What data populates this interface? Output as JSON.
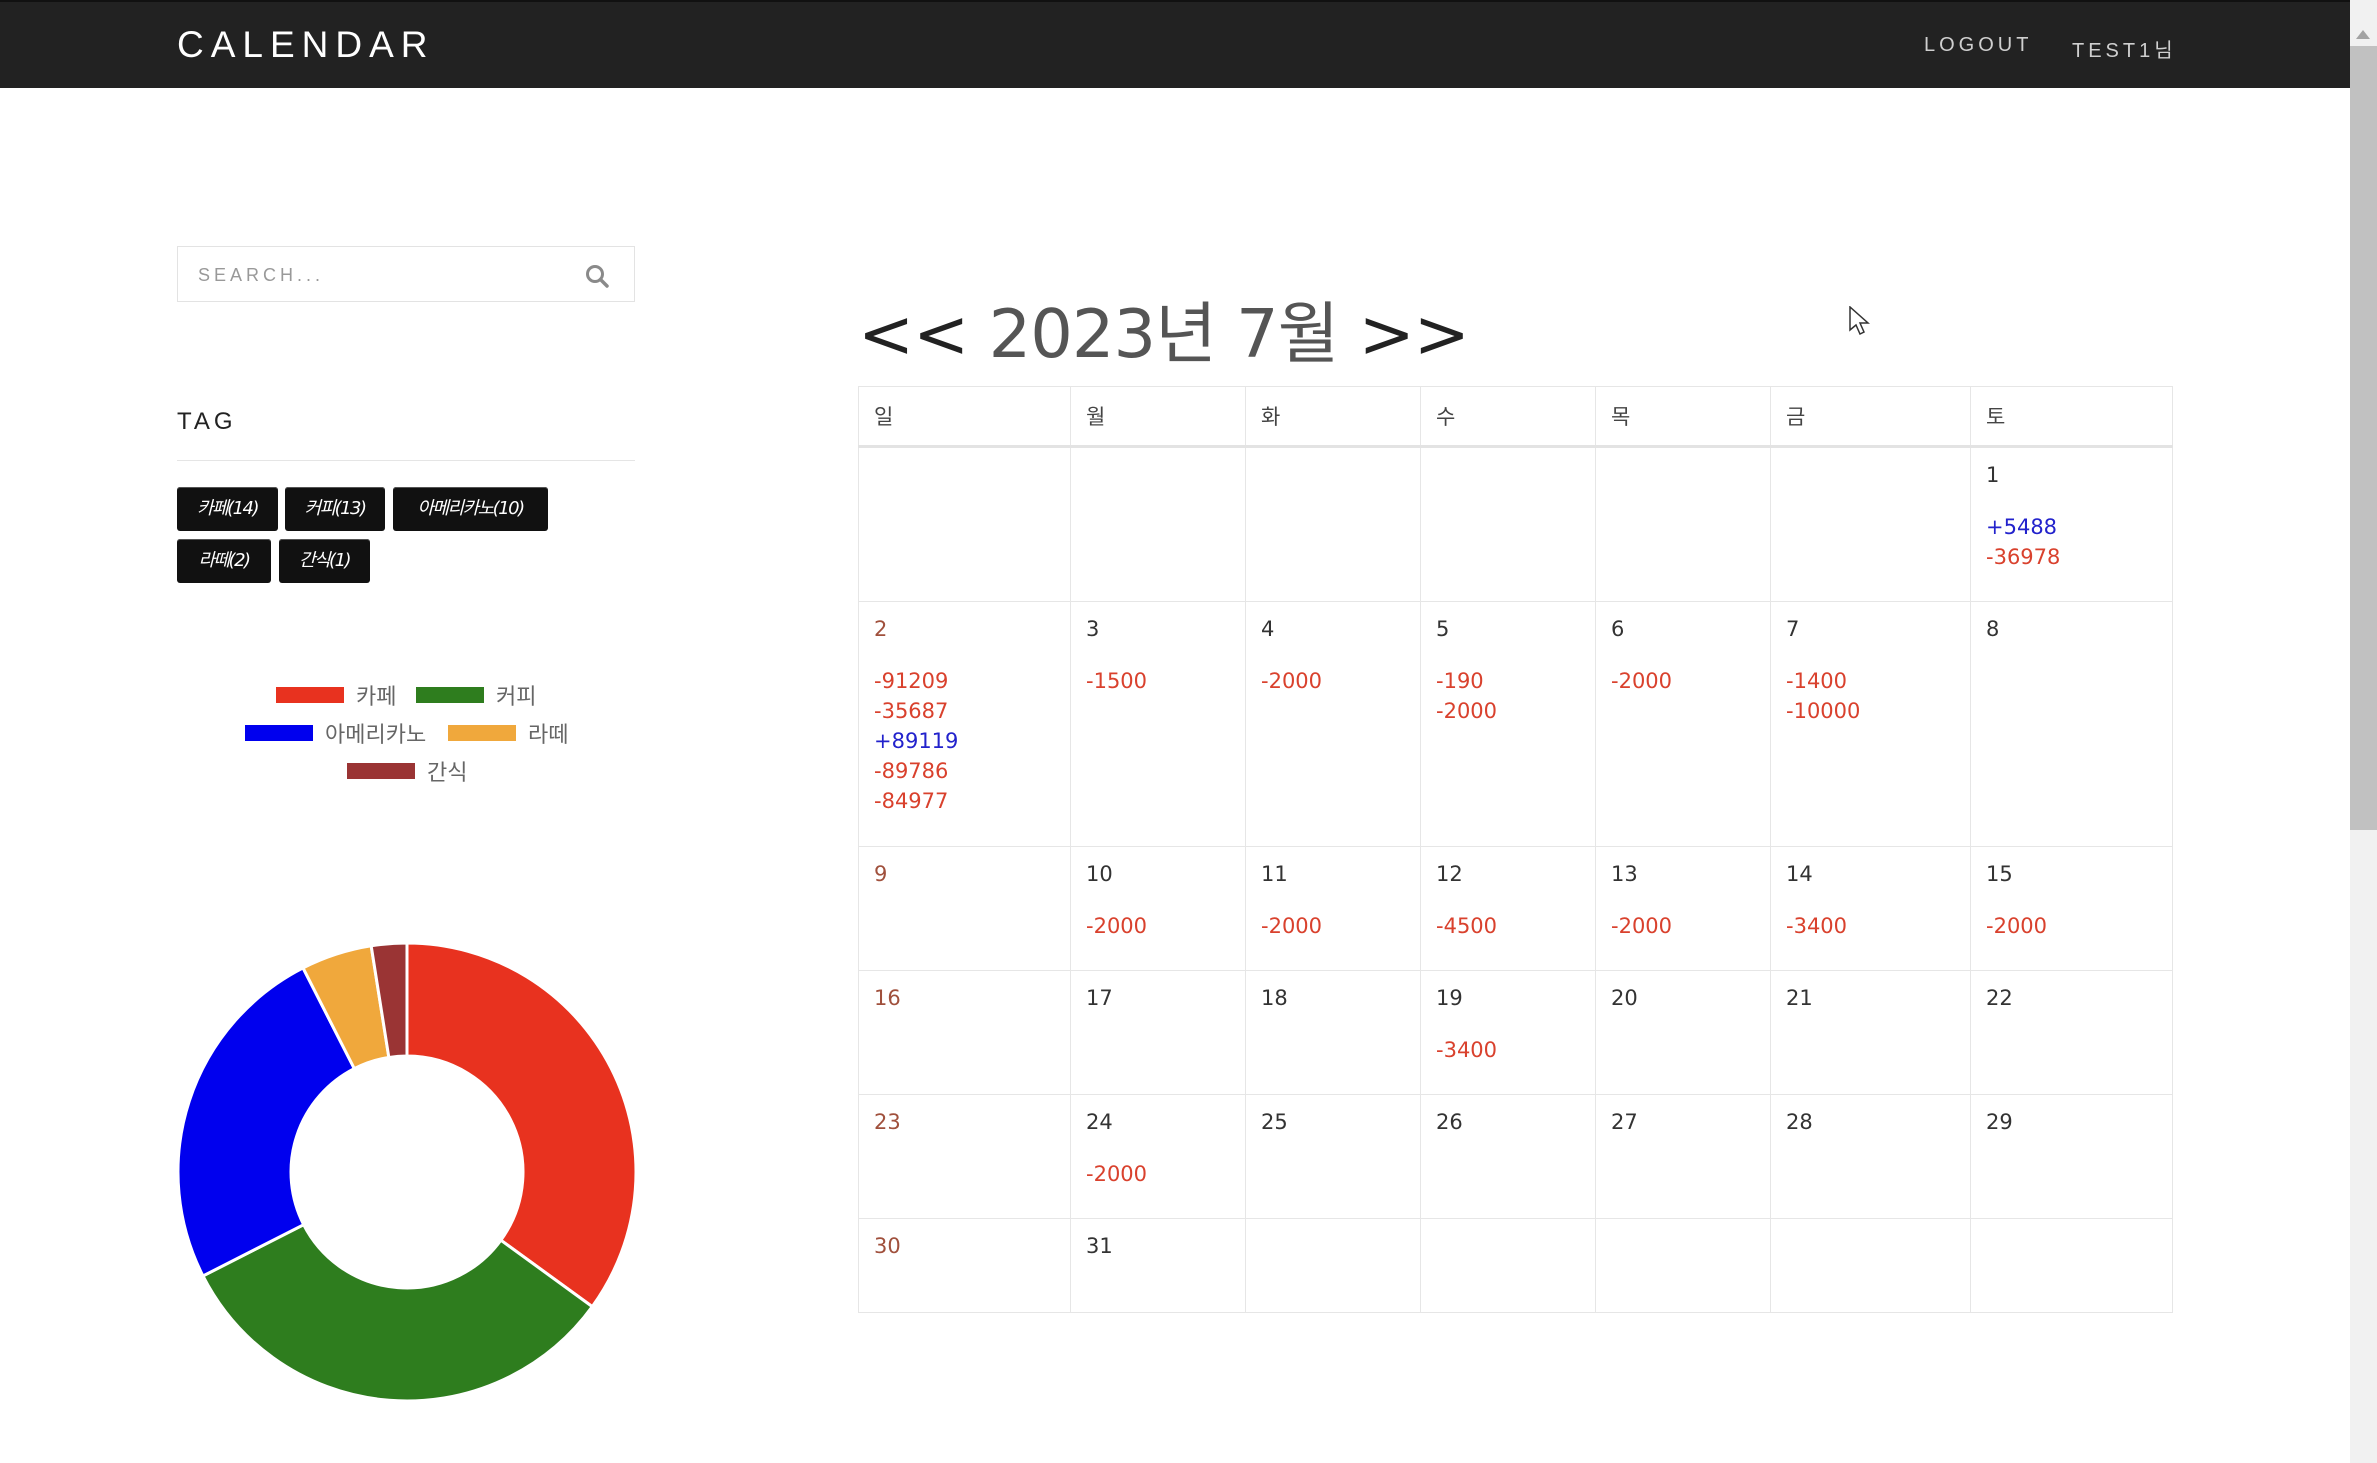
{
  "header": {
    "brand": "CALENDAR",
    "logout": "LOGOUT",
    "user": "TEST1님"
  },
  "sidebar": {
    "search_placeholder": "SEARCH...",
    "tag_heading": "TAG",
    "tags": [
      {
        "label": "카페(14)"
      },
      {
        "label": "커피(13)"
      },
      {
        "label": "아메리카노(10)"
      },
      {
        "label": "라떼(2)"
      },
      {
        "label": "간식(1)"
      }
    ]
  },
  "chart_data": {
    "type": "pie",
    "title": "",
    "categories": [
      "카페",
      "커피",
      "아메리카노",
      "라떼",
      "간식"
    ],
    "values": [
      14,
      13,
      10,
      2,
      1
    ],
    "colors": [
      "#e8321f",
      "#2e7d1e",
      "#0000ee",
      "#f0a83c",
      "#9a3434"
    ],
    "donut": true,
    "legend_position": "top"
  },
  "calendar": {
    "title_prefix": "<<",
    "title": "2023년 7월",
    "title_suffix": ">>",
    "weekdays": [
      "일",
      "월",
      "화",
      "수",
      "목",
      "금",
      "토"
    ],
    "weeks": [
      [
        {
          "day": "",
          "amounts": []
        },
        {
          "day": "",
          "amounts": []
        },
        {
          "day": "",
          "amounts": []
        },
        {
          "day": "",
          "amounts": []
        },
        {
          "day": "",
          "amounts": []
        },
        {
          "day": "",
          "amounts": []
        },
        {
          "day": "1",
          "amounts": [
            "+5488",
            "-36978"
          ]
        }
      ],
      [
        {
          "day": "2",
          "amounts": [
            "-91209",
            "-35687",
            "+89119",
            "-89786",
            "-84977"
          ]
        },
        {
          "day": "3",
          "amounts": [
            "-1500"
          ]
        },
        {
          "day": "4",
          "amounts": [
            "-2000"
          ]
        },
        {
          "day": "5",
          "amounts": [
            "-190",
            "-2000"
          ]
        },
        {
          "day": "6",
          "amounts": [
            "-2000"
          ]
        },
        {
          "day": "7",
          "amounts": [
            "-1400",
            "-10000"
          ]
        },
        {
          "day": "8",
          "amounts": []
        }
      ],
      [
        {
          "day": "9",
          "amounts": []
        },
        {
          "day": "10",
          "amounts": [
            "-2000"
          ]
        },
        {
          "day": "11",
          "amounts": [
            "-2000"
          ]
        },
        {
          "day": "12",
          "amounts": [
            "-4500"
          ]
        },
        {
          "day": "13",
          "amounts": [
            "-2000"
          ]
        },
        {
          "day": "14",
          "amounts": [
            "-3400"
          ]
        },
        {
          "day": "15",
          "amounts": [
            "-2000"
          ]
        }
      ],
      [
        {
          "day": "16",
          "amounts": []
        },
        {
          "day": "17",
          "amounts": []
        },
        {
          "day": "18",
          "amounts": []
        },
        {
          "day": "19",
          "amounts": [
            "-3400"
          ]
        },
        {
          "day": "20",
          "amounts": []
        },
        {
          "day": "21",
          "amounts": []
        },
        {
          "day": "22",
          "amounts": []
        }
      ],
      [
        {
          "day": "23",
          "amounts": []
        },
        {
          "day": "24",
          "amounts": [
            "-2000"
          ]
        },
        {
          "day": "25",
          "amounts": []
        },
        {
          "day": "26",
          "amounts": []
        },
        {
          "day": "27",
          "amounts": []
        },
        {
          "day": "28",
          "amounts": []
        },
        {
          "day": "29",
          "amounts": []
        }
      ],
      [
        {
          "day": "30",
          "amounts": []
        },
        {
          "day": "31",
          "amounts": []
        },
        {
          "day": "",
          "amounts": []
        },
        {
          "day": "",
          "amounts": []
        },
        {
          "day": "",
          "amounts": []
        },
        {
          "day": "",
          "amounts": []
        },
        {
          "day": "",
          "amounts": []
        }
      ]
    ]
  }
}
